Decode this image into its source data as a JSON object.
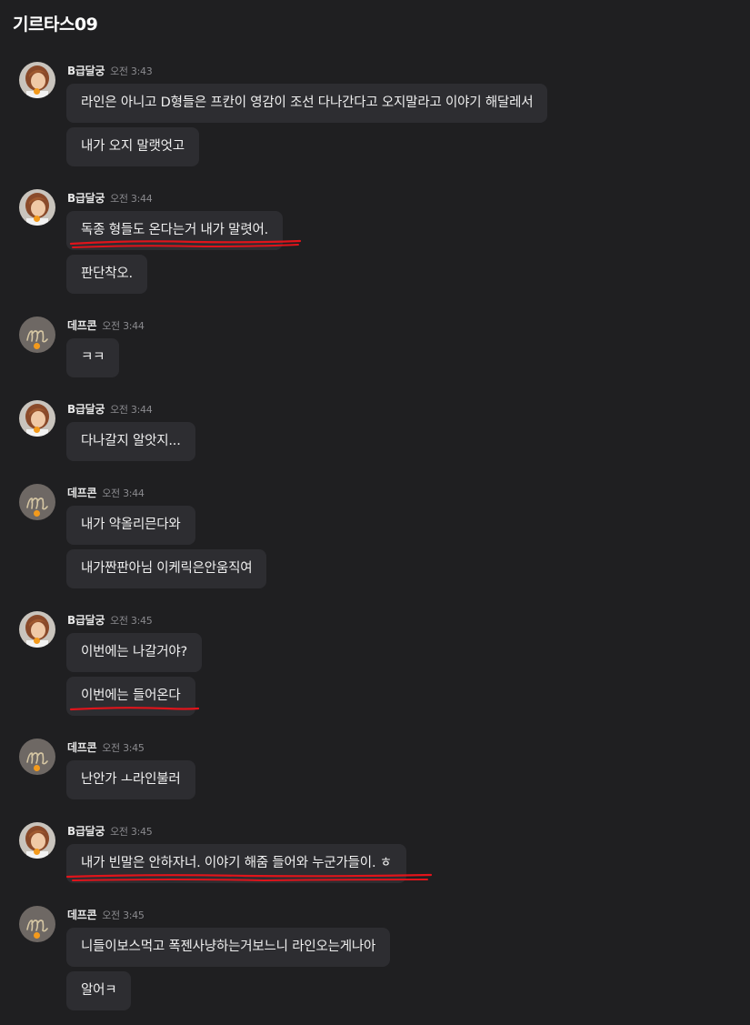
{
  "channel": {
    "title": "기르타스09"
  },
  "colors": {
    "background": "#1f1f21",
    "bubble": "#2d2d31",
    "status": "#f39a1c",
    "annotation": "#e0141b"
  },
  "groups": [
    {
      "user": "B급달궁",
      "time": "오전 3:43",
      "avatar": "character-avatar",
      "messages": [
        "라인은 아니고 D형들은 프칸이 영감이 조선 다나간다고 오지말라고 이야기 해달레서",
        "내가 오지 말랫엇고"
      ]
    },
    {
      "user": "B급달궁",
      "time": "오전 3:44",
      "avatar": "character-avatar",
      "messages": [
        "독종 형들도 온다는거 내가 말렷어.",
        "판단착오."
      ]
    },
    {
      "user": "데프콘",
      "time": "오전 3:44",
      "avatar": "monogram-avatar",
      "messages": [
        "ㅋㅋ"
      ]
    },
    {
      "user": "B급달궁",
      "time": "오전 3:44",
      "avatar": "character-avatar",
      "messages": [
        "다나갈지 알앗지..."
      ]
    },
    {
      "user": "데프콘",
      "time": "오전 3:44",
      "avatar": "monogram-avatar",
      "messages": [
        "내가 약올리믄다와",
        "내가짠판아님 이케릭은안움직여"
      ]
    },
    {
      "user": "B급달궁",
      "time": "오전 3:45",
      "avatar": "character-avatar",
      "messages": [
        "이번에는 나갈거야?",
        "이번에는 들어온다"
      ]
    },
    {
      "user": "데프콘",
      "time": "오전 3:45",
      "avatar": "monogram-avatar",
      "messages": [
        "난안가 ㅗ라인불러"
      ]
    },
    {
      "user": "B급달궁",
      "time": "오전 3:45",
      "avatar": "character-avatar",
      "messages": [
        "내가 빈말은 안하자너.  이야기 해줌 들어와 누군가들이.  ㅎ"
      ]
    },
    {
      "user": "데프콘",
      "time": "오전 3:45",
      "avatar": "monogram-avatar",
      "messages": [
        "니들이보스먹고 폭젠사냥하는거보느니 라인오는게나아",
        "알어ㅋ"
      ]
    }
  ]
}
